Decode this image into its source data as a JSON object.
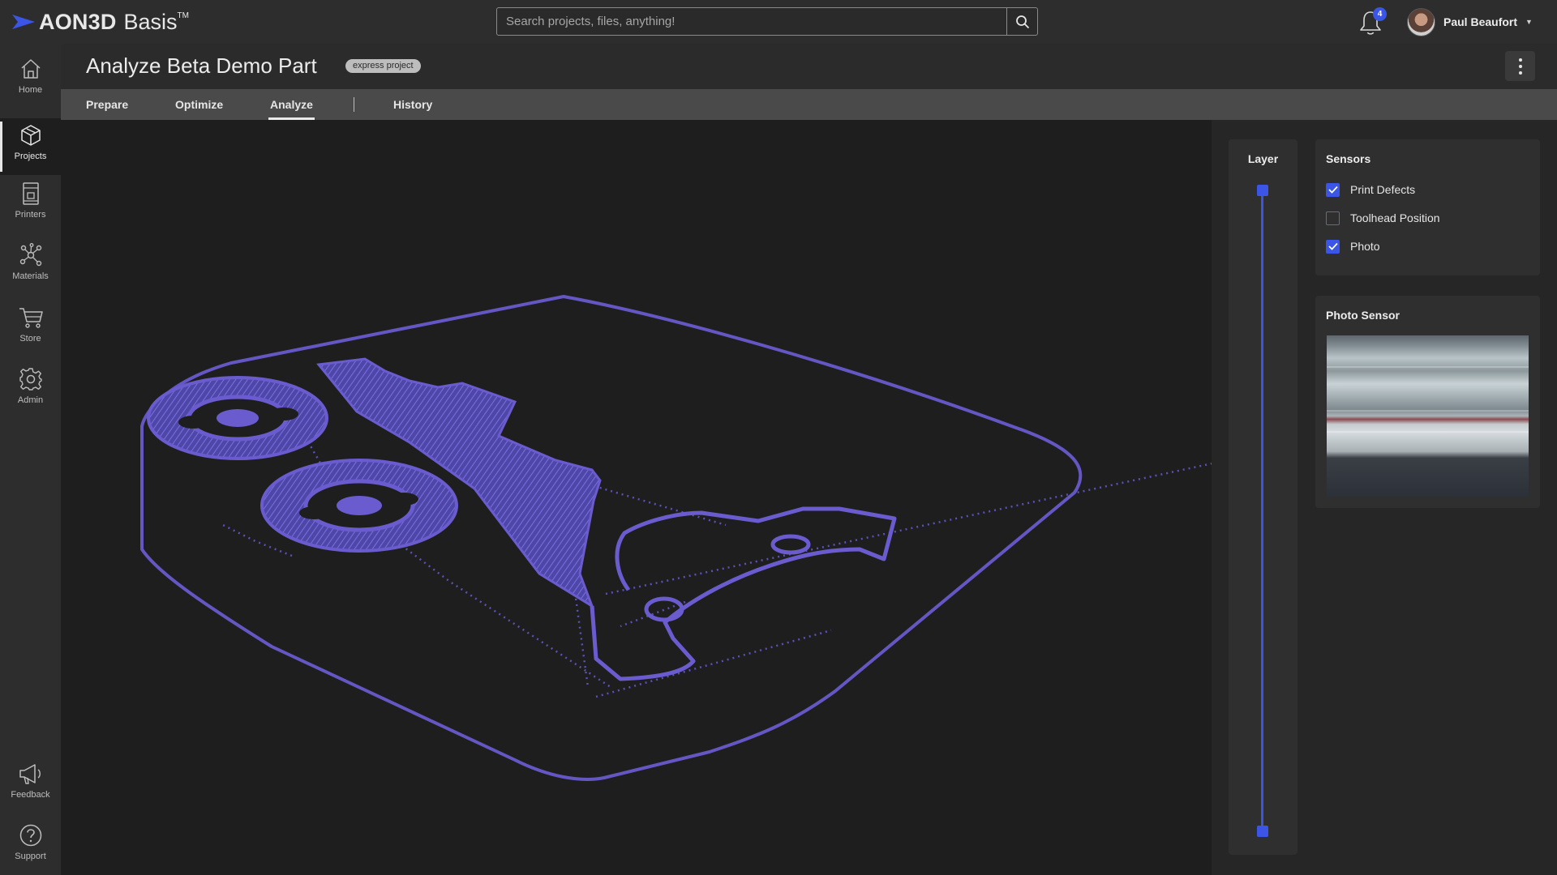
{
  "app": {
    "brand": "AON3D",
    "product": "Basis",
    "trademark": "TM"
  },
  "search": {
    "placeholder": "Search projects, files, anything!",
    "value": ""
  },
  "notifications": {
    "count": "4"
  },
  "user": {
    "name": "Paul Beaufort"
  },
  "sidebar": {
    "items": [
      {
        "label": "Home",
        "icon": "home-icon"
      },
      {
        "label": "Projects",
        "icon": "cube-icon",
        "active": true
      },
      {
        "label": "Printers",
        "icon": "printer-icon"
      },
      {
        "label": "Materials",
        "icon": "molecule-icon"
      },
      {
        "label": "Store",
        "icon": "cart-icon"
      },
      {
        "label": "Admin",
        "icon": "gear-icon"
      },
      {
        "label": "Feedback",
        "icon": "megaphone-icon"
      },
      {
        "label": "Support",
        "icon": "help-icon"
      }
    ]
  },
  "header": {
    "title": "Analyze Beta Demo Part",
    "badge": "express project"
  },
  "tabs": [
    {
      "label": "Prepare"
    },
    {
      "label": "Optimize"
    },
    {
      "label": "Analyze",
      "active": true
    },
    {
      "label": "History"
    }
  ],
  "layer_panel": {
    "title": "Layer"
  },
  "sensors": {
    "title": "Sensors",
    "items": [
      {
        "label": "Print Defects",
        "checked": true
      },
      {
        "label": "Toolhead Position",
        "checked": false
      },
      {
        "label": "Photo",
        "checked": true
      }
    ]
  },
  "photo_sensor": {
    "title": "Photo Sensor"
  },
  "colors": {
    "accent": "#3b55e6",
    "toolpath": "#6a5acd",
    "background": "#1e1e1f",
    "panel": "#2f2f30"
  }
}
